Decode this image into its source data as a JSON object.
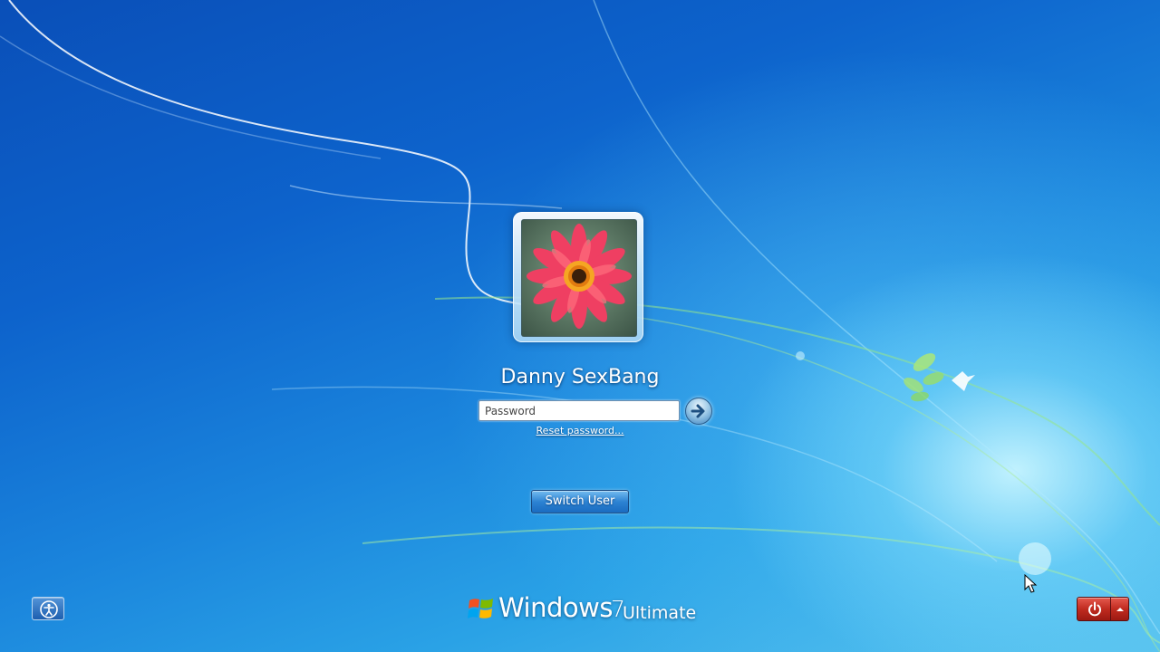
{
  "user": {
    "name": "Danny SexBang",
    "picture_icon": "flower-user-picture"
  },
  "login": {
    "password_placeholder": "Password",
    "password_value": "",
    "submit_icon": "arrow-right-icon",
    "reset_password_label": "Reset password..."
  },
  "switch_user_label": "Switch User",
  "ease_of_access": {
    "icon": "ease-of-access-icon"
  },
  "branding": {
    "windows": "Windows",
    "version": "7",
    "edition": "Ultimate"
  },
  "power": {
    "shutdown_icon": "power-icon",
    "options_icon": "chevron-up-icon"
  },
  "colors": {
    "background_dark": "#0a4fb8",
    "background_light": "#59c4ef",
    "shutdown_red": "#c02b20",
    "switch_user_blue": "#2d82d2"
  }
}
